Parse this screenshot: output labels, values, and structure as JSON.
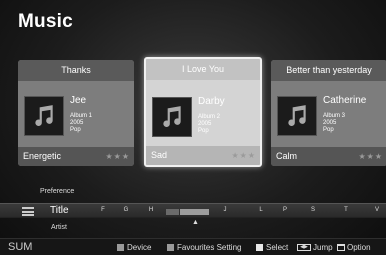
{
  "header": {
    "title": "Music"
  },
  "cards": [
    {
      "song": "Thanks",
      "artist": "Jee",
      "album": "Album 1",
      "year": "2005",
      "genre": "Pop",
      "mood": "Energetic",
      "rating": "★★★"
    },
    {
      "song": "I Love You",
      "artist": "Darby",
      "album": "Album 2",
      "year": "2005",
      "genre": "Pop",
      "mood": "Sad",
      "rating": "★★★"
    },
    {
      "song": "Better than yesterday",
      "artist": "Catherine",
      "album": "Album 3",
      "year": "2005",
      "genre": "Pop",
      "mood": "Calm",
      "rating": "★★★"
    }
  ],
  "sort": {
    "above": "Preference",
    "current": "Title",
    "below": "Artist",
    "index": [
      "F",
      "G",
      "H",
      "J",
      "L",
      "P",
      "S",
      "T",
      "V"
    ],
    "caret": "▲"
  },
  "help": {
    "source": "SUM",
    "device": "Device",
    "favourites": "Favourites Setting",
    "select": "Select",
    "jump_icon": "◀▶",
    "jump": "Jump",
    "option": "Option"
  }
}
